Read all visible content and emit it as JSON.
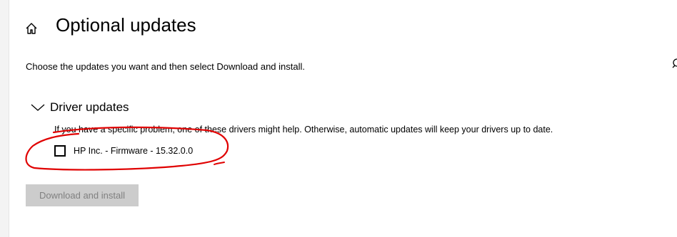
{
  "page": {
    "title": "Optional updates",
    "subtitle": "Choose the updates you want and then select Download and install."
  },
  "section": {
    "title": "Driver updates",
    "expanded": true,
    "description": "If you have a specific problem, one of these drivers might help. Otherwise, automatic updates will keep your drivers up to date.",
    "items": [
      {
        "label": "HP Inc. - Firmware - 15.32.0.0",
        "checked": false
      }
    ]
  },
  "actions": {
    "download_label": "Download and install",
    "download_enabled": false
  },
  "icons": {
    "home": "home-icon",
    "chevron": "chevron-down-icon",
    "search": "search-icon"
  },
  "colors": {
    "annotation": "#e00000",
    "button_disabled_bg": "#cccccc",
    "button_disabled_text": "#808080"
  }
}
